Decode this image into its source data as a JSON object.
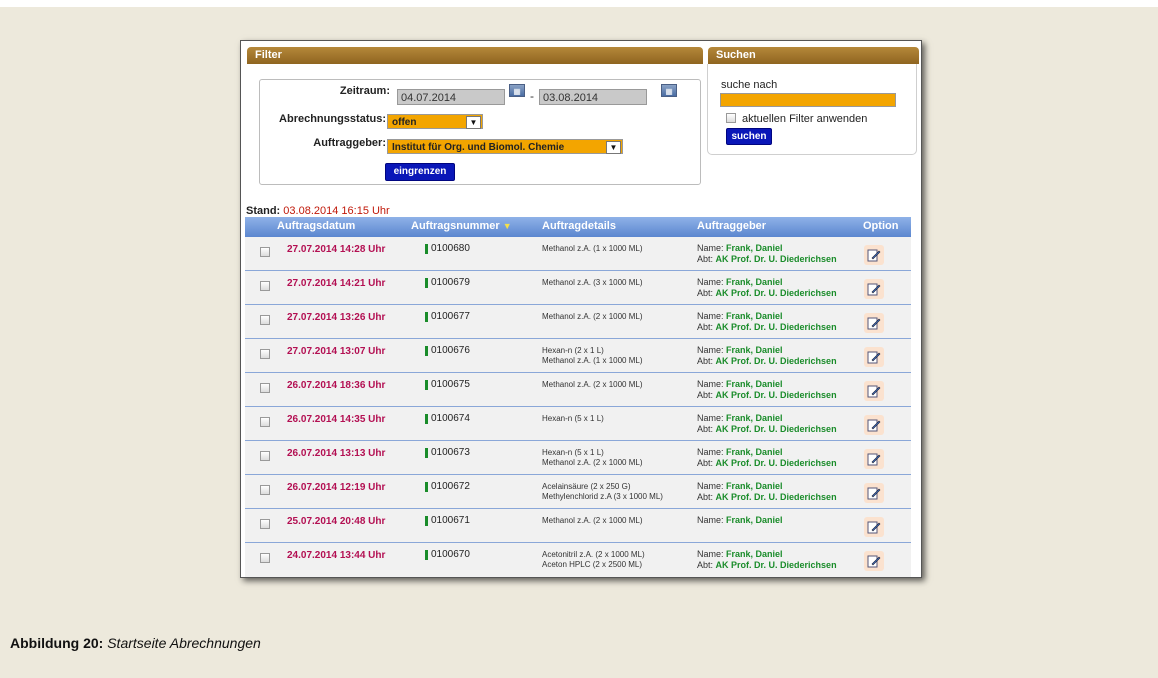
{
  "filter": {
    "title": "Filter",
    "zeitraum_label": "Zeitraum:",
    "date_from": "04.07.2014",
    "date_to": "03.08.2014",
    "dash": "-",
    "status_label": "Abrechnungsstatus:",
    "status_value": "offen",
    "auftraggeber_label": "Auftraggeber:",
    "auftraggeber_value": "Institut für Org. und Biomol. Chemie",
    "submit_label": "eingrenzen"
  },
  "search": {
    "title": "Suchen",
    "label": "suche nach",
    "value": "",
    "checkbox_label": "aktuellen Filter anwenden",
    "submit_label": "suchen"
  },
  "stand": {
    "label": "Stand:",
    "value": "03.08.2014 16:15 Uhr"
  },
  "table": {
    "headers": {
      "date": "Auftragsdatum",
      "number": "Auftragsnummer",
      "details": "Auftragdetails",
      "client": "Auftraggeber",
      "option": "Option"
    },
    "name_prefix": "Name:",
    "abt_prefix": "Abt:",
    "rows": [
      {
        "date": "27.07.2014 14:28 Uhr",
        "number": "0100680",
        "details": [
          "Methanol z.A. (1 x 1000 ML)"
        ],
        "name": "Frank, Daniel",
        "abt": "AK Prof. Dr. U. Diederichsen"
      },
      {
        "date": "27.07.2014 14:21 Uhr",
        "number": "0100679",
        "details": [
          "Methanol z.A. (3 x 1000 ML)"
        ],
        "name": "Frank, Daniel",
        "abt": "AK Prof. Dr. U. Diederichsen"
      },
      {
        "date": "27.07.2014 13:26 Uhr",
        "number": "0100677",
        "details": [
          "Methanol z.A. (2 x 1000 ML)"
        ],
        "name": "Frank, Daniel",
        "abt": "AK Prof. Dr. U. Diederichsen"
      },
      {
        "date": "27.07.2014 13:07 Uhr",
        "number": "0100676",
        "details": [
          "Hexan-n (2 x 1 L)",
          "Methanol z.A. (1 x 1000 ML)"
        ],
        "name": "Frank, Daniel",
        "abt": "AK Prof. Dr. U. Diederichsen"
      },
      {
        "date": "26.07.2014 18:36 Uhr",
        "number": "0100675",
        "details": [
          "Methanol z.A. (2 x 1000 ML)"
        ],
        "name": "Frank, Daniel",
        "abt": "AK Prof. Dr. U. Diederichsen"
      },
      {
        "date": "26.07.2014 14:35 Uhr",
        "number": "0100674",
        "details": [
          "Hexan-n (5 x 1 L)"
        ],
        "name": "Frank, Daniel",
        "abt": "AK Prof. Dr. U. Diederichsen"
      },
      {
        "date": "26.07.2014 13:13 Uhr",
        "number": "0100673",
        "details": [
          "Hexan-n (5 x 1 L)",
          "Methanol z.A. (2 x 1000 ML)"
        ],
        "name": "Frank, Daniel",
        "abt": "AK Prof. Dr. U. Diederichsen"
      },
      {
        "date": "26.07.2014 12:19 Uhr",
        "number": "0100672",
        "details": [
          "Acelainsäure (2 x 250 G)",
          "Methylenchlorid z.A (3 x 1000 ML)"
        ],
        "name": "Frank, Daniel",
        "abt": "AK Prof. Dr. U. Diederichsen"
      },
      {
        "date": "25.07.2014 20:48 Uhr",
        "number": "0100671",
        "details": [
          "Methanol z.A. (2 x 1000 ML)"
        ],
        "name": "Frank, Daniel",
        "abt": ""
      },
      {
        "date": "24.07.2014 13:44 Uhr",
        "number": "0100670",
        "details": [
          "Acetonitril z.A. (2 x 1000 ML)",
          "Aceton HPLC (2 x 2500 ML)"
        ],
        "name": "Frank, Daniel",
        "abt": "AK Prof. Dr. U. Diederichsen"
      }
    ]
  },
  "caption": {
    "label": "Abbildung 20:",
    "text": "Startseite Abrechnungen"
  },
  "colors": {
    "panel_header": "#a67a2e",
    "input_orange": "#f3a500",
    "button_blue": "#0a17b8",
    "table_header": "#6f96d9",
    "date_text": "#b30f52",
    "name_green": "#1a8c2a"
  },
  "icons": {
    "calendar": "calendar-icon",
    "dropdown": "chevron-down-icon",
    "edit": "edit-icon",
    "sort": "sort-arrow-icon"
  }
}
